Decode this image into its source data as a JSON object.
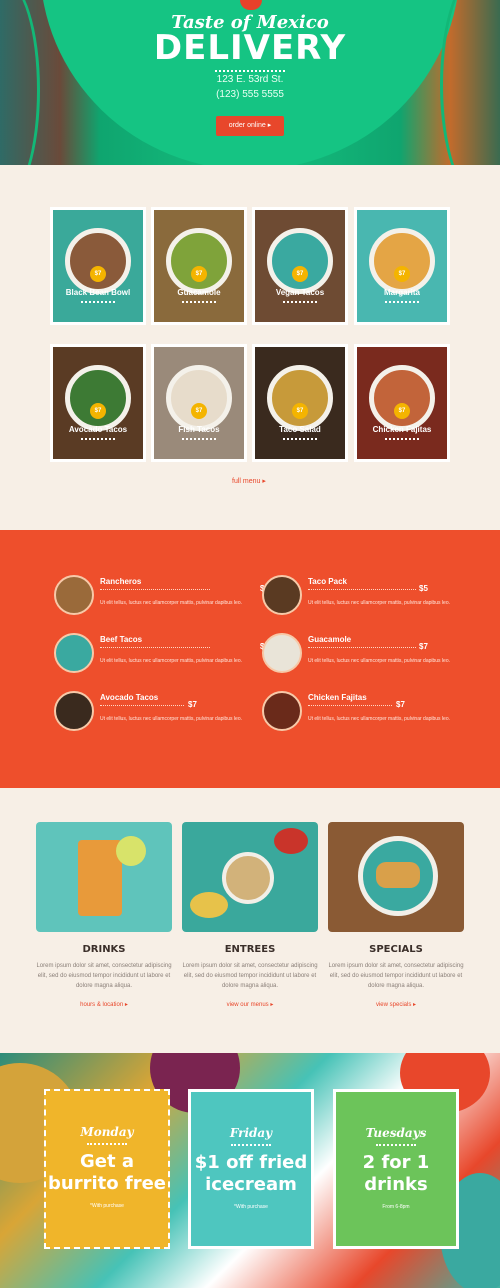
{
  "hero": {
    "script": "Taste of Mexico",
    "title": "DELIVERY",
    "address": "123 E. 53rd St.",
    "phone": "(123) 555 5555",
    "order_label": "order online",
    "colors": {
      "green": "#15c483",
      "button": "#e8472b"
    }
  },
  "dishes": [
    {
      "name": "Black Bean Bowl",
      "price": "$7",
      "bg": "#3aa99a",
      "bowl": "#8a5a3a"
    },
    {
      "name": "Guacamole",
      "price": "$7",
      "bg": "#8a6a3c",
      "bowl": "#7fa33a"
    },
    {
      "name": "Vegan Tacos",
      "price": "$7",
      "bg": "#6e4b33",
      "bowl": "#3aa9a0"
    },
    {
      "name": "Margarita",
      "price": "$7",
      "bg": "#49b7b0",
      "bowl": "#e4a545"
    },
    {
      "name": "Avocado Tacos",
      "price": "$7",
      "bg": "#5a3b24",
      "bowl": "#3d7a34"
    },
    {
      "name": "Fish Tacos",
      "price": "$7",
      "bg": "#9a8a7a",
      "bowl": "#e7dccb"
    },
    {
      "name": "Taco Salad",
      "price": "$7",
      "bg": "#3a2a1e",
      "bowl": "#c79a3a"
    },
    {
      "name": "Chicken Fajitas",
      "price": "$7",
      "bg": "#7a2a1e",
      "bowl": "#c2643a"
    }
  ],
  "full_menu_label": "full menu",
  "menu_list": [
    {
      "name": "Rancheros",
      "price": "$7",
      "desc": "Ut elit tellus, luctus nec ullamcorper mattis, pulvinar dapibus leo."
    },
    {
      "name": "Taco Pack",
      "price": "$5",
      "desc": "Ut elit tellus, luctus nec ullamcorper mattis, pulvinar dapibus leo."
    },
    {
      "name": "Beef Tacos",
      "price": "$7",
      "desc": "Ut elit tellus, luctus nec ullamcorper mattis, pulvinar dapibus leo."
    },
    {
      "name": "Guacamole",
      "price": "$7",
      "desc": "Ut elit tellus, luctus nec ullamcorper mattis, pulvinar dapibus leo."
    },
    {
      "name": "Avocado Tacos",
      "price": "$7",
      "desc": "Ut elit tellus, luctus nec ullamcorper mattis, pulvinar dapibus leo."
    },
    {
      "name": "Chicken Fajitas",
      "price": "$7",
      "desc": "Ut elit tellus, luctus nec ullamcorper mattis, pulvinar dapibus leo."
    }
  ],
  "categories": [
    {
      "title": "DRINKS",
      "text": "Lorem ipsum dolor sit amet, consectetur adipiscing elit, sed do eiusmod tempor incididunt ut labore et dolore magna aliqua.",
      "link": "hours & location"
    },
    {
      "title": "ENTREES",
      "text": "Lorem ipsum dolor sit amet, consectetur adipiscing elit, sed do eiusmod tempor incididunt ut labore et dolore magna aliqua.",
      "link": "view our menus"
    },
    {
      "title": "SPECIALS",
      "text": "Lorem ipsum dolor sit amet, consectetur adipiscing elit, sed do eiusmod tempor incididunt ut labore et dolore magna aliqua.",
      "link": "view specials"
    }
  ],
  "promos": [
    {
      "day": "Monday",
      "headline": "Get a burrito free",
      "note": "*With purchase",
      "color": "#f0b52a"
    },
    {
      "day": "Friday",
      "headline": "$1 off fried icecream",
      "note": "*With purchase",
      "color": "#4ec6bf"
    },
    {
      "day": "Tuesdays",
      "headline": "2 for 1 drinks",
      "note": "From 6-8pm",
      "color": "#6cc45a"
    }
  ]
}
